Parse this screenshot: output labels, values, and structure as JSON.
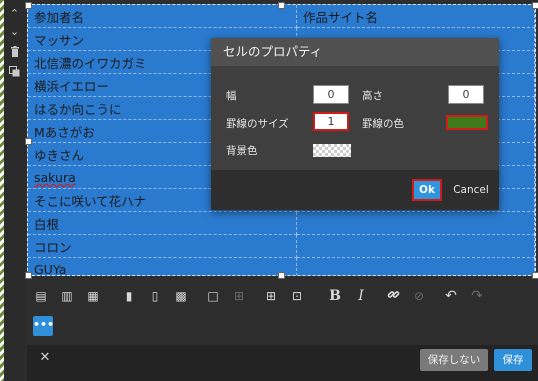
{
  "table": {
    "rows": [
      [
        "参加者名",
        "作品サイト名"
      ],
      [
        "マッサン",
        ""
      ],
      [
        "北信濃のイワカガミ",
        ""
      ],
      [
        "横浜イエロー",
        ""
      ],
      [
        "はるか向こうに",
        ""
      ],
      [
        "Mあさがお",
        ""
      ],
      [
        "ゆきさん",
        ""
      ],
      [
        "sakura",
        ""
      ],
      [
        "そこに咲いて花ハナ",
        ""
      ],
      [
        "白根",
        ""
      ],
      [
        "コロン",
        ""
      ],
      [
        "GUYa",
        ""
      ]
    ]
  },
  "dialog": {
    "title": "セルのプロパティ",
    "width_label": "幅",
    "width_value": "0",
    "height_label": "高さ",
    "height_value": "0",
    "border_size_label": "罫線のサイズ",
    "border_size_value": "1",
    "border_color_label": "罫線の色",
    "border_color_value": "#3f7a1a",
    "bg_color_label": "背景色",
    "ok_label": "Ok",
    "cancel_label": "Cancel"
  },
  "toolbar": {
    "more_label": "•••"
  },
  "footer": {
    "close_label": "✕",
    "no_save_label": "保存しない",
    "save_label": "保存"
  },
  "colors": {
    "table_selection": "#2a7ad0",
    "accent": "#2f8fd8",
    "highlight": "#d21a1a"
  }
}
